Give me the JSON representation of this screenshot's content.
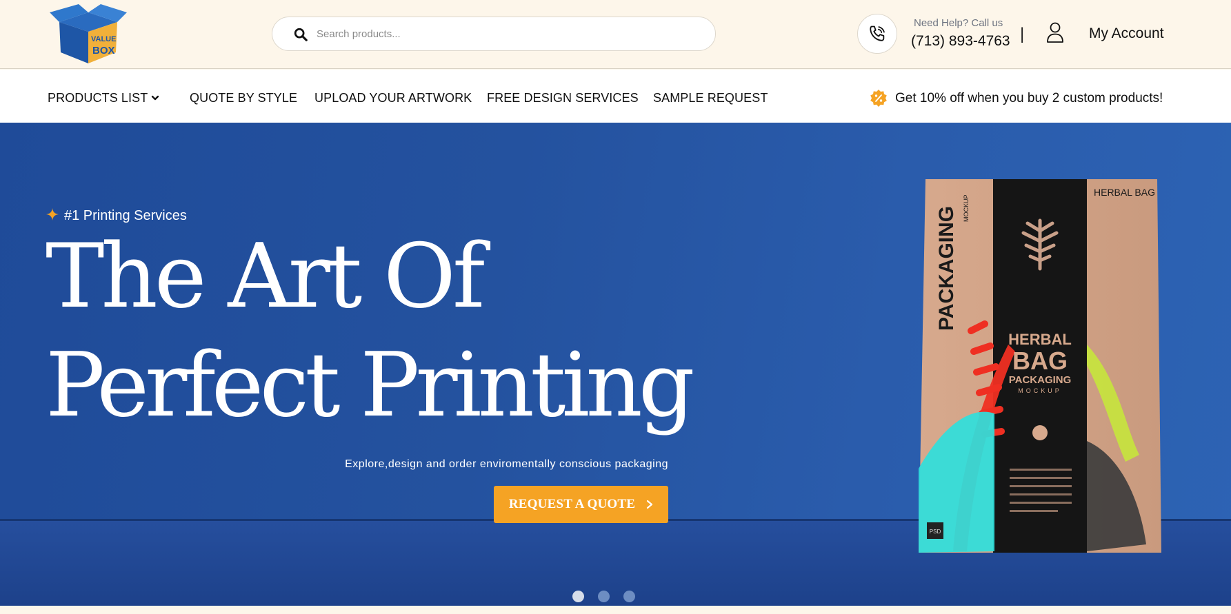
{
  "header": {
    "logo_text": [
      "VALUE",
      "BOX"
    ],
    "search": {
      "placeholder": "Search products..."
    },
    "help_label": "Need Help? Call us",
    "phone": "(713) 893-4763",
    "divider": "|",
    "account_label": "My Account"
  },
  "nav": {
    "items": [
      {
        "label": "PRODUCTS LIST"
      },
      {
        "label": "QUOTE BY STYLE"
      },
      {
        "label": "UPLOAD YOUR ARTWORK"
      },
      {
        "label": "FREE DESIGN SERVICES"
      },
      {
        "label": "SAMPLE REQUEST"
      }
    ],
    "promo": "Get 10% off when you buy 2 custom products!"
  },
  "hero": {
    "eyebrow": "#1 Printing Services",
    "title_line1": "The Art Of",
    "title_line2": "Perfect Printing",
    "subtitle": "Explore,design and order enviromentally conscious packaging",
    "cta_label": "REQUEST A QUOTE",
    "bag": {
      "side_title": "PACKAGING",
      "side_sub": "MOCKUP",
      "top_right": "HERBAL BAG",
      "center_1": "HERBAL",
      "center_2": "BAG",
      "center_3": "PACKAGING",
      "center_4": "MOCKUP",
      "badge": "PSD"
    },
    "carousel": {
      "total": 3,
      "active": 1
    }
  },
  "colors": {
    "accent": "#f5a324",
    "hero_blue": "#24529f",
    "topbar_bg": "#fdf6ea"
  }
}
